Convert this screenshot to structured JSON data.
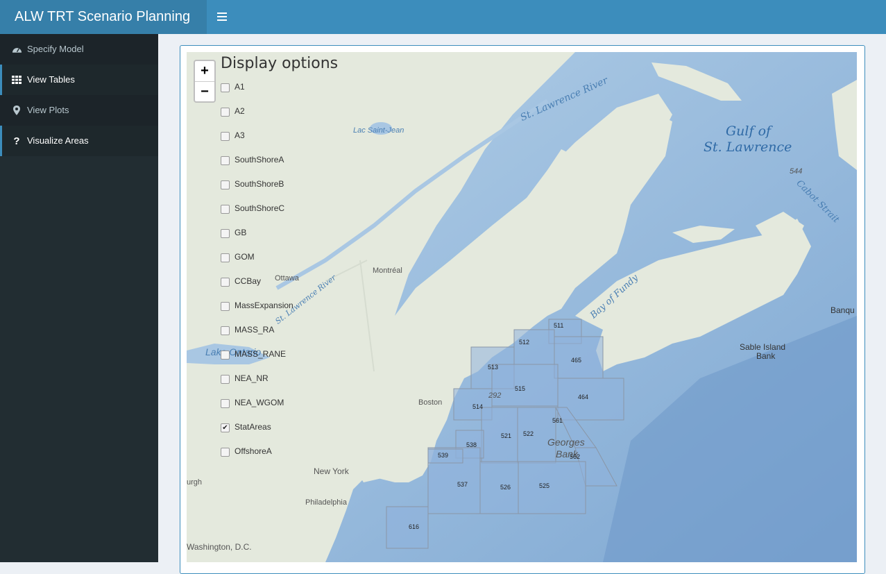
{
  "header": {
    "title": "ALW TRT Scenario Planning",
    "menu_icon": "hamburger-icon",
    "colors": {
      "header_bg": "#3c8dbc",
      "brand_bg": "#367fa9",
      "sidebar_bg": "#222d32"
    }
  },
  "sidebar": {
    "items": [
      {
        "label": "Specify Model",
        "icon": "dashboard-icon"
      },
      {
        "label": "View Tables",
        "icon": "grid-icon"
      },
      {
        "label": "View Plots",
        "icon": "map-marker-icon"
      },
      {
        "label": "Visualize Areas",
        "icon": "question-icon"
      }
    ]
  },
  "map": {
    "zoom_in": "+",
    "zoom_out": "−",
    "display_title": "Display options",
    "layers": [
      {
        "label": "A1",
        "checked": false
      },
      {
        "label": "A2",
        "checked": false
      },
      {
        "label": "A3",
        "checked": false
      },
      {
        "label": "SouthShoreA",
        "checked": false
      },
      {
        "label": "SouthShoreB",
        "checked": false
      },
      {
        "label": "SouthShoreC",
        "checked": false
      },
      {
        "label": "GB",
        "checked": false
      },
      {
        "label": "GOM",
        "checked": false
      },
      {
        "label": "CCBay",
        "checked": false
      },
      {
        "label": "MassExpansion",
        "checked": false
      },
      {
        "label": "MASS_RA",
        "checked": false
      },
      {
        "label": "MASS_RANE",
        "checked": false
      },
      {
        "label": "NEA_NR",
        "checked": false
      },
      {
        "label": "NEA_WGOM",
        "checked": false
      },
      {
        "label": "StatAreas",
        "checked": true
      },
      {
        "label": "OffshoreA",
        "checked": false
      }
    ],
    "place_labels": {
      "st_lawrence_river": "St. Lawrence River",
      "lac_saint_jean": "Lac Saint-Jean",
      "gulf_line1": "Gulf of",
      "gulf_line2": "St. Lawrence",
      "cabot_strait": "Cabot Strait",
      "n544": "544",
      "ottawa": "Ottawa",
      "montreal": "Montréal",
      "st_lawrence_river_2": "St. Lawrence River",
      "bay_of_fundy": "Bay of Fundy",
      "banque": "Banqu",
      "sable_line1": "Sable Island",
      "sable_line2": "Bank",
      "lake_ontario": "Lake Ontario",
      "boston": "Boston",
      "georges_line1": "Georges",
      "georges_line2": "Bank",
      "new_york": "New York",
      "philadelphia": "Philadelphia",
      "washington": "Washington, D.C.",
      "pittsburgh": "urgh",
      "n292": "292"
    },
    "stat_areas": [
      "511",
      "512",
      "513",
      "514",
      "515",
      "465",
      "464",
      "521",
      "522",
      "561",
      "562",
      "538",
      "539",
      "537",
      "526",
      "525",
      "616"
    ]
  }
}
